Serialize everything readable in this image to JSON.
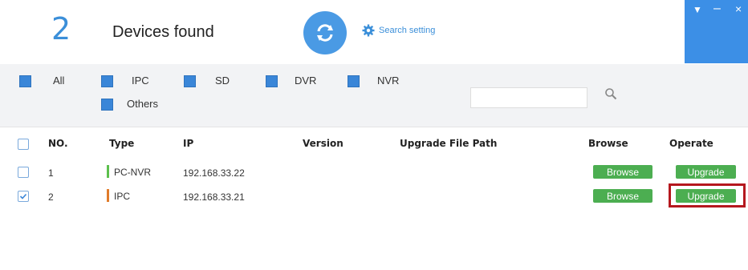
{
  "header": {
    "count": "2",
    "found_label": "Devices found",
    "search_setting_label": "Search setting"
  },
  "window_controls": {
    "dropdown": "▼",
    "minimize": "–",
    "close": "×"
  },
  "filters": {
    "all": "All",
    "ipc": "IPC",
    "sd": "SD",
    "dvr": "DVR",
    "nvr": "NVR",
    "others": "Others",
    "search_value": ""
  },
  "table": {
    "columns": [
      "NO.",
      "Type",
      "IP",
      "Version",
      "Upgrade File Path",
      "Browse",
      "Operate"
    ],
    "rows": [
      {
        "no": "1",
        "type": "PC-NVR",
        "type_color": "#5cc04d",
        "ip": "192.168.33.22",
        "version": "",
        "path": "",
        "browse": "Browse",
        "operate": "Upgrade",
        "checked": false
      },
      {
        "no": "2",
        "type": "IPC",
        "type_color": "#e07b2a",
        "ip": "192.168.33.21",
        "version": "",
        "path": "",
        "browse": "Browse",
        "operate": "Upgrade",
        "checked": true
      }
    ]
  },
  "colors": {
    "accent": "#3a86d8",
    "button_green": "#4cae51",
    "highlight_red": "#b5171e"
  }
}
